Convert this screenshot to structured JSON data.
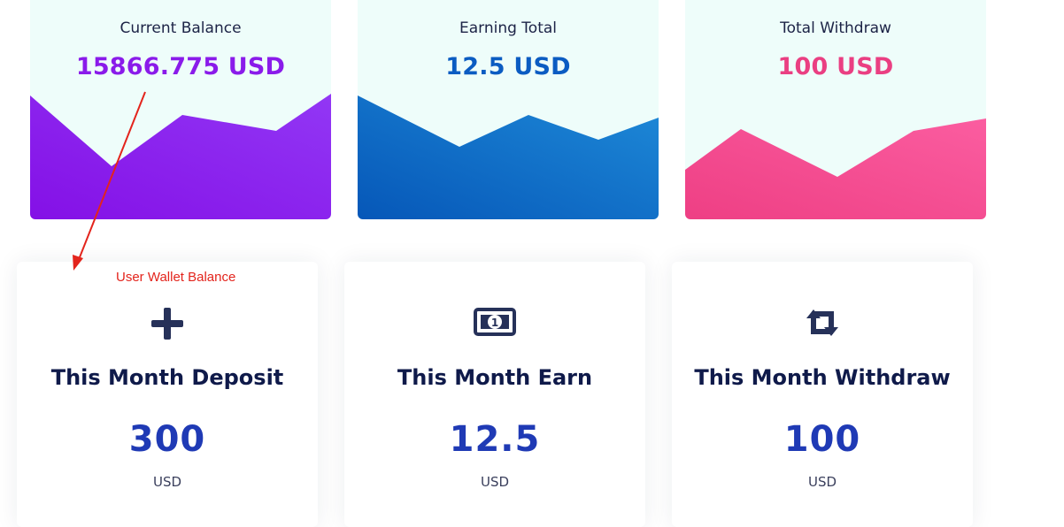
{
  "balances": [
    {
      "title": "Current Balance",
      "value": "15866.775 USD",
      "color": "#8a1bea"
    },
    {
      "title": "Earning Total",
      "value": "12.5 USD",
      "color": "#0b5cc2"
    },
    {
      "title": "Total Withdraw",
      "value": "100 USD",
      "color": "#ea3f82"
    }
  ],
  "stats": [
    {
      "icon": "plus-icon",
      "title": "This Month Deposit",
      "value": "300",
      "unit": "USD"
    },
    {
      "icon": "money-bill-icon",
      "title": "This Month Earn",
      "value": "12.5",
      "unit": "USD"
    },
    {
      "icon": "retweet-icon",
      "title": "This Month Withdraw",
      "value": "100",
      "unit": "USD"
    }
  ],
  "annotation": {
    "text": "User Wallet Balance",
    "color": "#e3241c"
  }
}
